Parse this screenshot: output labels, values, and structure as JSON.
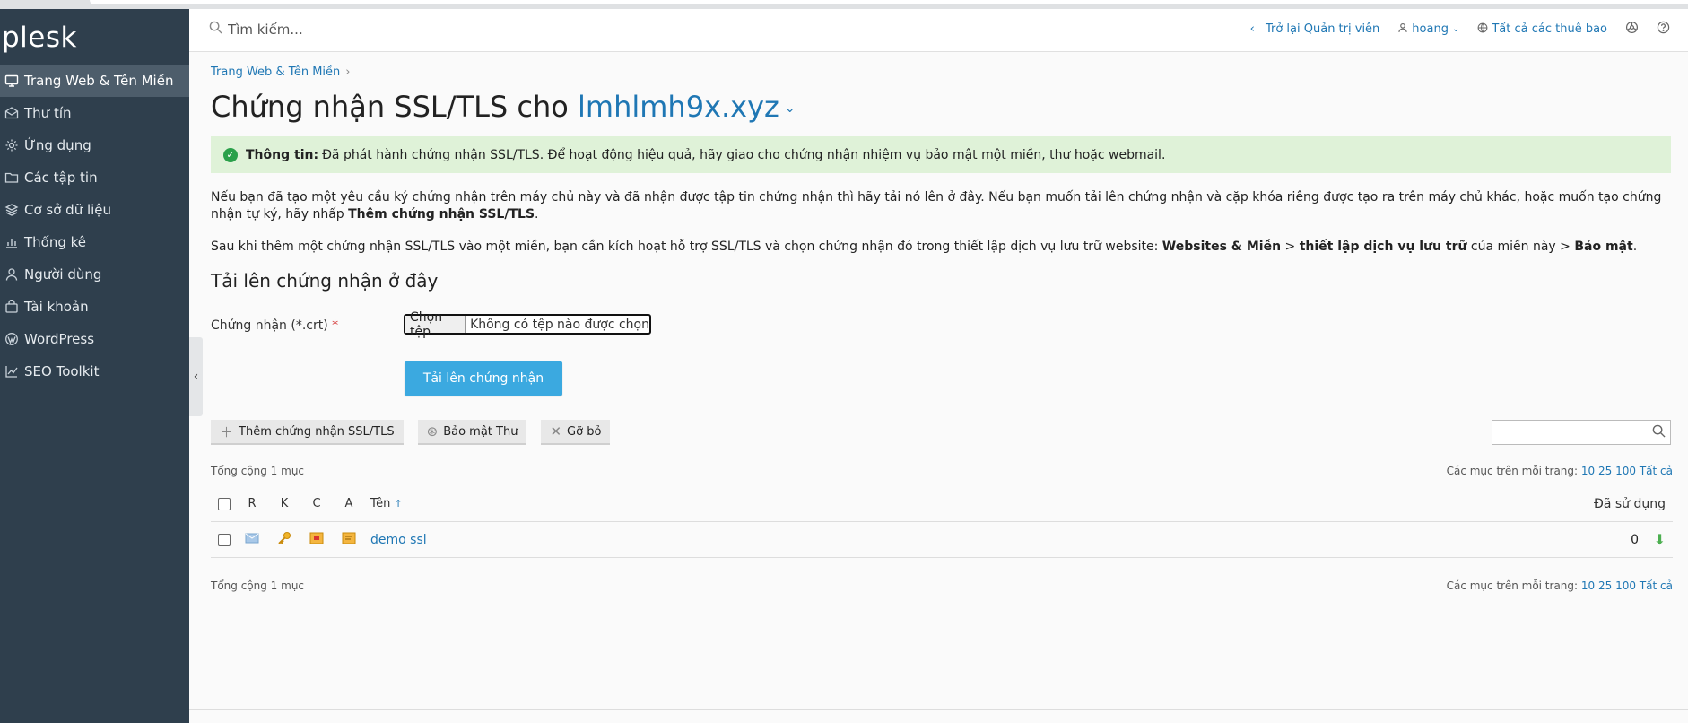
{
  "brand": "plesk",
  "sidebar": {
    "items": [
      {
        "label": "Trang Web & Tên Miền",
        "icon": "monitor-icon"
      },
      {
        "label": "Thư tín",
        "icon": "mail-icon"
      },
      {
        "label": "Ứng dụng",
        "icon": "gear-icon"
      },
      {
        "label": "Các tập tin",
        "icon": "folder-icon"
      },
      {
        "label": "Cơ sở dữ liệu",
        "icon": "database-icon"
      },
      {
        "label": "Thống kê",
        "icon": "chart-icon"
      },
      {
        "label": "Người dùng",
        "icon": "user-icon"
      },
      {
        "label": "Tài khoản",
        "icon": "account-icon"
      },
      {
        "label": "WordPress",
        "icon": "wordpress-icon"
      },
      {
        "label": "SEO Toolkit",
        "icon": "seo-icon"
      }
    ]
  },
  "header": {
    "search_placeholder": "Tìm kiếm...",
    "back_admin": "Trở lại Quản trị viên",
    "user": "hoang",
    "subscriptions": "Tất cả các thuê bao"
  },
  "breadcrumb": "Trang Web & Tên Miền",
  "title": {
    "prefix": "Chứng nhận SSL/TLS cho",
    "domain": "lmhlmh9x.xyz"
  },
  "message": {
    "label": "Thông tin:",
    "text": "Đã phát hành chứng nhận SSL/TLS. Để hoạt động hiệu quả, hãy giao cho chứng nhận nhiệm vụ bảo mật một miền, thư hoặc webmail."
  },
  "para1": {
    "text": "Nếu bạn đã tạo một yêu cầu ký chứng nhận trên máy chủ này và đã nhận được tập tin chứng nhận thì hãy tải nó lên ở đây. Nếu bạn muốn tải lên chứng nhận và cặp khóa riêng được tạo ra trên máy chủ khác, hoặc muốn tạo chứng nhận tự ký, hãy nhấp",
    "bold": "Thêm chứng nhận SSL/TLS",
    "end": "."
  },
  "para2": {
    "text": "Sau khi thêm một chứng nhận SSL/TLS vào một miền, bạn cần kích hoạt hỗ trợ SSL/TLS và chọn chứng nhận đó trong thiết lập dịch vụ lưu trữ website:",
    "b1": "Websites & Miền",
    "gt1": " > ",
    "b2": "thiết lập dịch vụ lưu trữ",
    "mid": " của miền này > ",
    "b3": "Bảo mật",
    "end": "."
  },
  "upload_heading": "Tải lên chứng nhận ở đây",
  "form": {
    "label": "Chứng nhận (*.crt)",
    "required": "*",
    "choose_file": "Chọn tệp",
    "no_file": "Không có tệp nào được chọn",
    "upload_button": "Tải lên chứng nhận"
  },
  "toolbar": {
    "add": "Thêm chứng nhận SSL/TLS",
    "secure_mail": "Bảo mật Thư",
    "remove": "Gỡ bỏ"
  },
  "list": {
    "total": "Tổng cộng 1 mục",
    "per_page_label": "Các mục trên mỗi trang:",
    "per_page_options": [
      "10",
      "25",
      "100",
      "Tất cả"
    ],
    "columns": {
      "r": "R",
      "k": "K",
      "c": "C",
      "a": "A",
      "name": "Tên",
      "sort": "↑",
      "used": "Đã sử dụng"
    },
    "rows": [
      {
        "name": "demo ssl",
        "used": "0"
      }
    ]
  }
}
